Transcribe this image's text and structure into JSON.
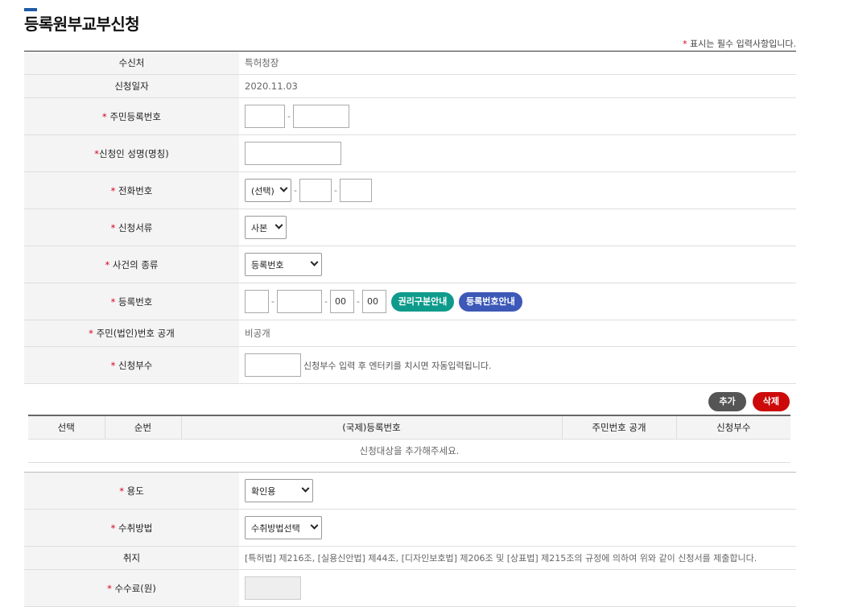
{
  "page": {
    "title": "등록원부교부신청",
    "required_mark": "*",
    "required_note": " 표시는 필수 입력사항입니다."
  },
  "form": {
    "recipient": {
      "label": "수신처",
      "value": "특허청장"
    },
    "apply_date": {
      "label": "신청일자",
      "value": "2020.11.03"
    },
    "rrn": {
      "label": "주민등록번호",
      "sep": "-"
    },
    "applicant_name": {
      "label": "신청인 성명(명칭)"
    },
    "phone": {
      "label": "전화번호",
      "select": "(선택)",
      "sep": "-"
    },
    "doc_type": {
      "label": "신청서류",
      "select": "사본"
    },
    "case_type": {
      "label": "사건의 종류",
      "select": "등록번호"
    },
    "reg_no": {
      "label": "등록번호",
      "sep": "-",
      "field3": "00",
      "field4": "00",
      "btn_rights_guide": "권리구분안내",
      "btn_regno_guide": "등록번호안내"
    },
    "rrn_public": {
      "label": "주민(법인)번호 공개",
      "value": "비공개"
    },
    "copies": {
      "label": "신청부수",
      "hint": "신청부수 입력 후 엔터키를 치시면 자동입력됩니다."
    }
  },
  "actions": {
    "add": "추가",
    "delete": "삭제"
  },
  "list": {
    "columns": [
      "선택",
      "순번",
      "(국제)등록번호",
      "주민번호 공개",
      "신청부수"
    ],
    "empty": "신청대상을 추가해주세요."
  },
  "form2": {
    "purpose": {
      "label": "용도",
      "select": "확인용"
    },
    "receive": {
      "label": "수취방법",
      "select": "수취방법선택"
    },
    "purport": {
      "label": "취지",
      "value": "[특허법] 제216조, [실용신안법] 제44조, [디자인보호법] 제206조 및 [상표법] 제215조의 규정에 의하여 위와 같이 신청서를 제출합니다."
    },
    "fee": {
      "label": "수수료(원)"
    }
  },
  "colors": {
    "accent": "#1f5aa8",
    "teal": "#0e9b8c",
    "blue": "#3d59b8",
    "red": "#cc0a0a",
    "dark": "#555555",
    "required": "#d6001c"
  }
}
